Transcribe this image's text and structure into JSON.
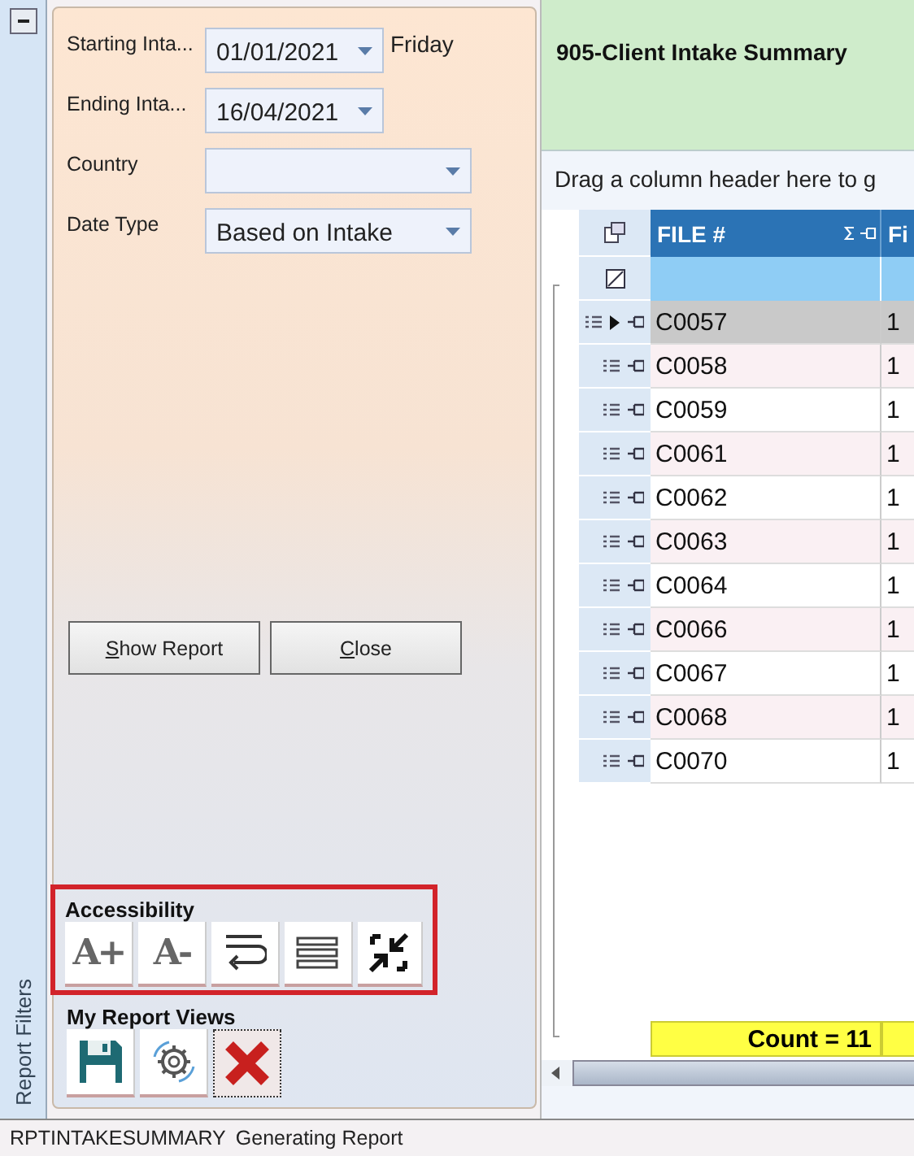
{
  "side_strip": {
    "label": "Report Filters"
  },
  "filters": [
    {
      "kind": "date",
      "label": "Starting Inta...",
      "value": "01/01/2021",
      "note": "Friday"
    },
    {
      "kind": "date",
      "label": "Ending Inta...",
      "value": "16/04/2021"
    },
    {
      "kind": "select",
      "label": "Country"
    },
    {
      "kind": "select",
      "label": "Date Type",
      "value": "Based on Intake"
    }
  ],
  "buttons": [
    {
      "label": "Show Report"
    },
    {
      "label": "Close"
    }
  ],
  "accessibility": {
    "title": "Accessibility",
    "tools": [
      {
        "kind": "text",
        "label": "A+"
      },
      {
        "kind": "text",
        "label": "A-"
      },
      {
        "kind": "wrap"
      },
      {
        "kind": "lines"
      },
      {
        "kind": "collapse"
      }
    ]
  },
  "report_views": {
    "title": "My Report Views",
    "tools": [
      {
        "kind": "save"
      },
      {
        "kind": "settings"
      },
      {
        "kind": "delete"
      }
    ]
  },
  "report": {
    "title": "905-Client Intake Summary",
    "group_hint": "Drag a column header here to g",
    "columns": [
      "FILE #",
      "Fi"
    ],
    "rows": [
      {
        "file": "C0057",
        "column_2": "1",
        "selected": true
      },
      {
        "file": "C0058",
        "column_2": "1",
        "selected": false
      },
      {
        "file": "C0059",
        "column_2": "1",
        "selected": false
      },
      {
        "file": "C0061",
        "column_2": "1",
        "selected": false
      },
      {
        "file": "C0062",
        "column_2": "1",
        "selected": false
      },
      {
        "file": "C0063",
        "column_2": "1",
        "selected": false
      },
      {
        "file": "C0064",
        "column_2": "1",
        "selected": false
      },
      {
        "file": "C0066",
        "column_2": "1",
        "selected": false
      },
      {
        "file": "C0067",
        "column_2": "1",
        "selected": false
      },
      {
        "file": "C0068",
        "column_2": "1",
        "selected": false
      },
      {
        "file": "C0070",
        "column_2": "1",
        "selected": false
      }
    ],
    "footer": "Count = 11"
  },
  "status_bar": [
    "RPTINTAKESUMMARY",
    "Generating Report"
  ]
}
